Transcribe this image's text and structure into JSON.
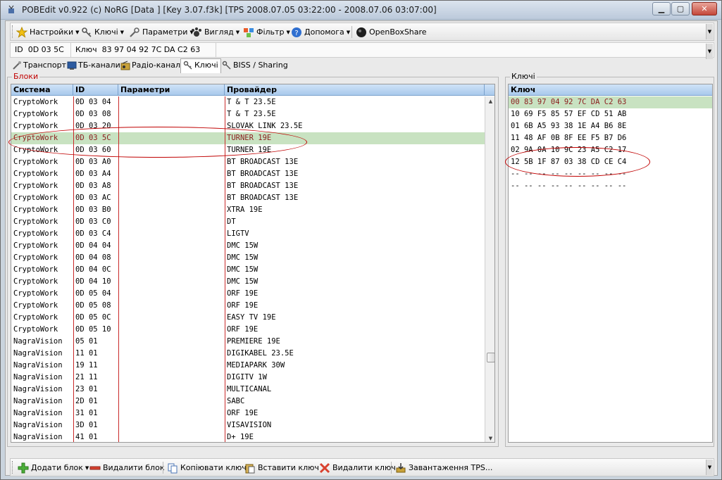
{
  "window": {
    "title": "POBEdit v0.922 (c) NoRG          [Data ] [Key 3.07.f3k] [TPS 2008.07.05 03:22:00 - 2008.07.06 03:07:00]",
    "min_glyph": "▁",
    "max_glyph": "▢",
    "close_glyph": "✕"
  },
  "toolbar": {
    "items": [
      {
        "label": "Настройки",
        "icon": "star-icon"
      },
      {
        "label": "Ключі",
        "icon": "key-icon"
      },
      {
        "label": "Параметри",
        "icon": "wrench-icon"
      },
      {
        "label": "Вигляд",
        "icon": "paw-icon"
      },
      {
        "label": "Фільтр",
        "icon": "filter-icon"
      },
      {
        "label": "Допомога",
        "icon": "help-icon"
      },
      {
        "label": "OpenBoxShare",
        "icon": "openbox-icon"
      }
    ],
    "caret": "▼"
  },
  "infobar": {
    "id_label": "ID",
    "id_value": "0D 03 5C",
    "key_label": "Ключ",
    "key_value": "83 97 04 92 7C DA C2 63"
  },
  "tabs": [
    {
      "label": "Транспорт",
      "icon": "transport-icon"
    },
    {
      "label": "ТБ-канали",
      "icon": "tv-icon"
    },
    {
      "label": "Радіо-канали",
      "icon": "radio-icon"
    },
    {
      "label": "Ключі",
      "icon": "key-icon",
      "active": true
    },
    {
      "label": "BISS / Sharing",
      "icon": "share-icon"
    }
  ],
  "blocks": {
    "legend": "Блоки",
    "columns": [
      "Система",
      "ID",
      "Параметри",
      "Провайдер"
    ],
    "rows": [
      [
        "CryptoWork",
        "0D 03 04",
        "",
        "T & T 23.5E"
      ],
      [
        "CryptoWork",
        "0D 03 08",
        "",
        "T & T 23.5E"
      ],
      [
        "CryptoWork",
        "0D 03 20",
        "",
        "SLOVAK LINK 23.5E"
      ],
      [
        "CryptoWork",
        "0D 03 5C",
        "",
        "TURNER 19E"
      ],
      [
        "CryptoWork",
        "0D 03 60",
        "",
        "TURNER 19E"
      ],
      [
        "CryptoWork",
        "0D 03 A0",
        "",
        "BT BROADCAST 13E"
      ],
      [
        "CryptoWork",
        "0D 03 A4",
        "",
        "BT BROADCAST 13E"
      ],
      [
        "CryptoWork",
        "0D 03 A8",
        "",
        "BT BROADCAST 13E"
      ],
      [
        "CryptoWork",
        "0D 03 AC",
        "",
        "BT BROADCAST 13E"
      ],
      [
        "CryptoWork",
        "0D 03 B0",
        "",
        "XTRA 19E"
      ],
      [
        "CryptoWork",
        "0D 03 C0",
        "",
        "DT"
      ],
      [
        "CryptoWork",
        "0D 03 C4",
        "",
        "LIGTV"
      ],
      [
        "CryptoWork",
        "0D 04 04",
        "",
        "DMC 15W"
      ],
      [
        "CryptoWork",
        "0D 04 08",
        "",
        "DMC 15W"
      ],
      [
        "CryptoWork",
        "0D 04 0C",
        "",
        "DMC 15W"
      ],
      [
        "CryptoWork",
        "0D 04 10",
        "",
        "DMC 15W"
      ],
      [
        "CryptoWork",
        "0D 05 04",
        "",
        "ORF 19E"
      ],
      [
        "CryptoWork",
        "0D 05 08",
        "",
        "ORF 19E"
      ],
      [
        "CryptoWork",
        "0D 05 0C",
        "",
        "EASY TV 19E"
      ],
      [
        "CryptoWork",
        "0D 05 10",
        "",
        "ORF 19E"
      ],
      [
        "NagraVision",
        "05 01",
        "",
        "PREMIERE 19E"
      ],
      [
        "NagraVision",
        "11 01",
        "",
        "DIGIKABEL 23.5E"
      ],
      [
        "NagraVision",
        "19 11",
        "",
        "MEDIAPARK 30W"
      ],
      [
        "NagraVision",
        "21 11",
        "",
        "DIGITV 1W"
      ],
      [
        "NagraVision",
        "23 01",
        "",
        "MULTICANAL"
      ],
      [
        "NagraVision",
        "2D 01",
        "",
        "SABC"
      ],
      [
        "NagraVision",
        "31 01",
        "",
        "ORF 19E"
      ],
      [
        "NagraVision",
        "3D 01",
        "",
        "VISAVISION"
      ],
      [
        "NagraVision",
        "41 01",
        "",
        "D+ 19E"
      ]
    ],
    "selected_index": 3
  },
  "keys": {
    "legend": "Ключі",
    "column": "Ключ",
    "rows": [
      "00 83 97 04 92 7C DA C2 63",
      "10 69 F5 85 57 EF CD 51 AB",
      "01 6B A5 93 38 1E A4 B6 8E",
      "11 48 AF 0B 8F EE F5 B7 D6",
      "02 9A 0A 10 9C 23 A5 C2 17",
      "12 5B 1F 87 03 38 CD CE C4",
      "-- -- -- -- -- -- -- -- --",
      "-- -- -- -- -- -- -- -- --"
    ],
    "selected_index": 0
  },
  "scroll": {
    "up": "▲",
    "down": "▼"
  },
  "bottom_toolbar": {
    "items": [
      {
        "label": "Додати блок",
        "icon": "add-icon",
        "caret": true
      },
      {
        "label": "Видалити блок",
        "icon": "remove-icon"
      },
      {
        "label": "Копіювати ключ",
        "icon": "copy-icon"
      },
      {
        "label": "Вставити ключ",
        "icon": "paste-icon"
      },
      {
        "label": "Видалити ключ",
        "icon": "delete-icon"
      },
      {
        "label": "Завантаження TPS...",
        "icon": "download-icon"
      }
    ]
  },
  "colors": {
    "selection_bg": "#c8e2c1",
    "selection_text": "#8a1d1d",
    "column_divider": "#c92a2a",
    "annotation": "#c00000",
    "header_bg": "#a9c9ec"
  }
}
